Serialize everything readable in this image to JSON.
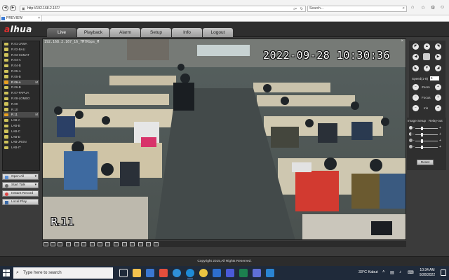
{
  "browser": {
    "url": "http://192.168.2.167/",
    "search_placeholder": "Search...",
    "tab_label": "PREVIEW"
  },
  "app": {
    "logo": "alhua",
    "menu": [
      "Live",
      "Playback",
      "Alarm",
      "Setup",
      "Info",
      "Logout"
    ],
    "active_menu": "Live"
  },
  "cameras": [
    {
      "label": "R.01-JAWA",
      "mark": ""
    },
    {
      "label": "R.02-BALI",
      "mark": ""
    },
    {
      "label": "R.03-SUMAT",
      "mark": ""
    },
    {
      "label": "R.04-A",
      "mark": ""
    },
    {
      "label": "R.04-B",
      "mark": ""
    },
    {
      "label": "R.05-A",
      "mark": ""
    },
    {
      "label": "R.05-B",
      "mark": ""
    },
    {
      "label": "R.06-A",
      "mark": "M",
      "active": true
    },
    {
      "label": "R.06-B",
      "mark": ""
    },
    {
      "label": "R.07-PAPUA",
      "mark": ""
    },
    {
      "label": "R.08-LOMBO",
      "mark": ""
    },
    {
      "label": "R.09",
      "mark": ""
    },
    {
      "label": "R.10",
      "mark": ""
    },
    {
      "label": "R.11",
      "mark": "M",
      "active": true
    },
    {
      "label": "LAB-A",
      "mark": ""
    },
    {
      "label": "LAB-B",
      "mark": ""
    },
    {
      "label": "LAB-C",
      "mark": ""
    },
    {
      "label": "LAB-D",
      "mark": ""
    },
    {
      "label": "LAB-JRGN",
      "mark": ""
    },
    {
      "label": "LAB-IT",
      "mark": ""
    }
  ],
  "side_buttons": {
    "open_all": "Open All",
    "start_talk": "Start Talk",
    "instant_record": "Instant Record",
    "local_play": "Local Play"
  },
  "video": {
    "channel_osd": "192.168.2.167_16_7M7Kbps_M",
    "timestamp": "2022-09-28 10:30:36",
    "room_label": "R.11",
    "close": "×"
  },
  "ptz": {
    "speed_label": "Speed(1-8)",
    "speed_value": "5",
    "zoom_label": "Zoom",
    "focus_label": "Focus",
    "iris_label": "Iris"
  },
  "image_setup": {
    "tab1": "Image Setup",
    "tab2": "Relay-out",
    "reset": "Reset"
  },
  "footer": {
    "copyright": "Copyright 2015,All Rights Reserved."
  },
  "taskbar": {
    "search_placeholder": "Type here to search",
    "weather": "33°C  Kabut",
    "time": "10:34 AM",
    "date": "9/28/2022"
  }
}
